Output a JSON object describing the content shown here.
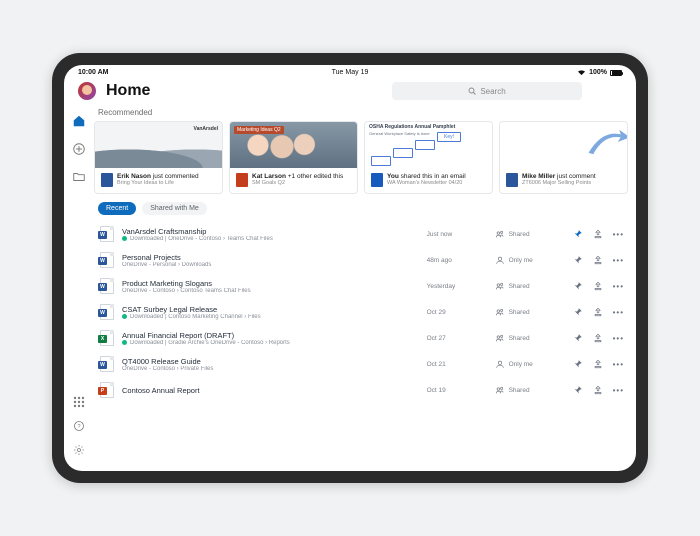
{
  "status": {
    "time": "10:00 AM",
    "date": "Tue May 19",
    "battery": "100%"
  },
  "header": {
    "title": "Home",
    "search_placeholder": "Search"
  },
  "sidebar": {
    "items": [
      "home",
      "add",
      "folder"
    ],
    "bottom": [
      "apps",
      "help",
      "settings"
    ]
  },
  "recommended": {
    "label": "Recommended",
    "cards": [
      {
        "thumb_brand": "VanArsdel",
        "icon": "word",
        "line1_name": "Erik Nason",
        "line1_action": " just commented",
        "line2": "Bring Your Ideas to Life"
      },
      {
        "thumb_badge": "Marketing Ideas Q2",
        "icon": "ppt",
        "line1_name": "Kat Larson",
        "line1_action": " +1 other edited this",
        "line2": "SM Goals Q2"
      },
      {
        "thumb_title": "OSHA Regulations Annual Pamphlet",
        "thumb_sub": "General Workplace Safety is #one",
        "key_label": "Key!",
        "icon": "word",
        "line1_name": "You",
        "line1_action": " shared this in an email",
        "line2": "WA Woman's Newsletter 04/20"
      },
      {
        "icon": "word",
        "line1_name": "Mike Miller",
        "line1_action": " just comment",
        "line2": "ZT6006 Major Selling Points"
      }
    ]
  },
  "tabs": {
    "items": [
      "Recent",
      "Shared with Me"
    ],
    "active": 0
  },
  "files": [
    {
      "type": "word",
      "name": "VanArsdel Craftsmanship",
      "cloud": true,
      "status": "Downloaded",
      "path": "OneDrive - Contoso › Teams Chat Files",
      "time": "Just now",
      "share": "Shared",
      "pinned": true
    },
    {
      "type": "word",
      "name": "Personal Projects",
      "cloud": false,
      "status": "",
      "path": "OneDrive - Personal › Downloads",
      "time": "48m ago",
      "share": "Only me",
      "pinned": false
    },
    {
      "type": "word",
      "name": "Product Marketing Slogans",
      "cloud": false,
      "status": "",
      "path": "OneDrive - Contoso › Contoso Teams Chat Files",
      "time": "Yesterday",
      "share": "Shared",
      "pinned": false
    },
    {
      "type": "word",
      "name": "CSAT Surbey Legal Release",
      "cloud": true,
      "status": "Downloaded",
      "path": "Contoso Marketing Channel › Files",
      "time": "Oct 29",
      "share": "Shared",
      "pinned": false
    },
    {
      "type": "xls",
      "name": "Annual Financial Report (DRAFT)",
      "cloud": true,
      "status": "Downloaded",
      "path": "Gradie Archie's OneDrive - Contoso › Reports",
      "time": "Oct 27",
      "share": "Shared",
      "pinned": false
    },
    {
      "type": "word",
      "name": "QT4000 Release Guide",
      "cloud": false,
      "status": "",
      "path": "OneDrive - Contoso › Private Files",
      "time": "Oct 21",
      "share": "Only me",
      "pinned": false
    },
    {
      "type": "ppt",
      "name": "Contoso Annual Report",
      "cloud": false,
      "status": "",
      "path": "",
      "time": "Oct 19",
      "share": "Shared",
      "pinned": false
    }
  ]
}
